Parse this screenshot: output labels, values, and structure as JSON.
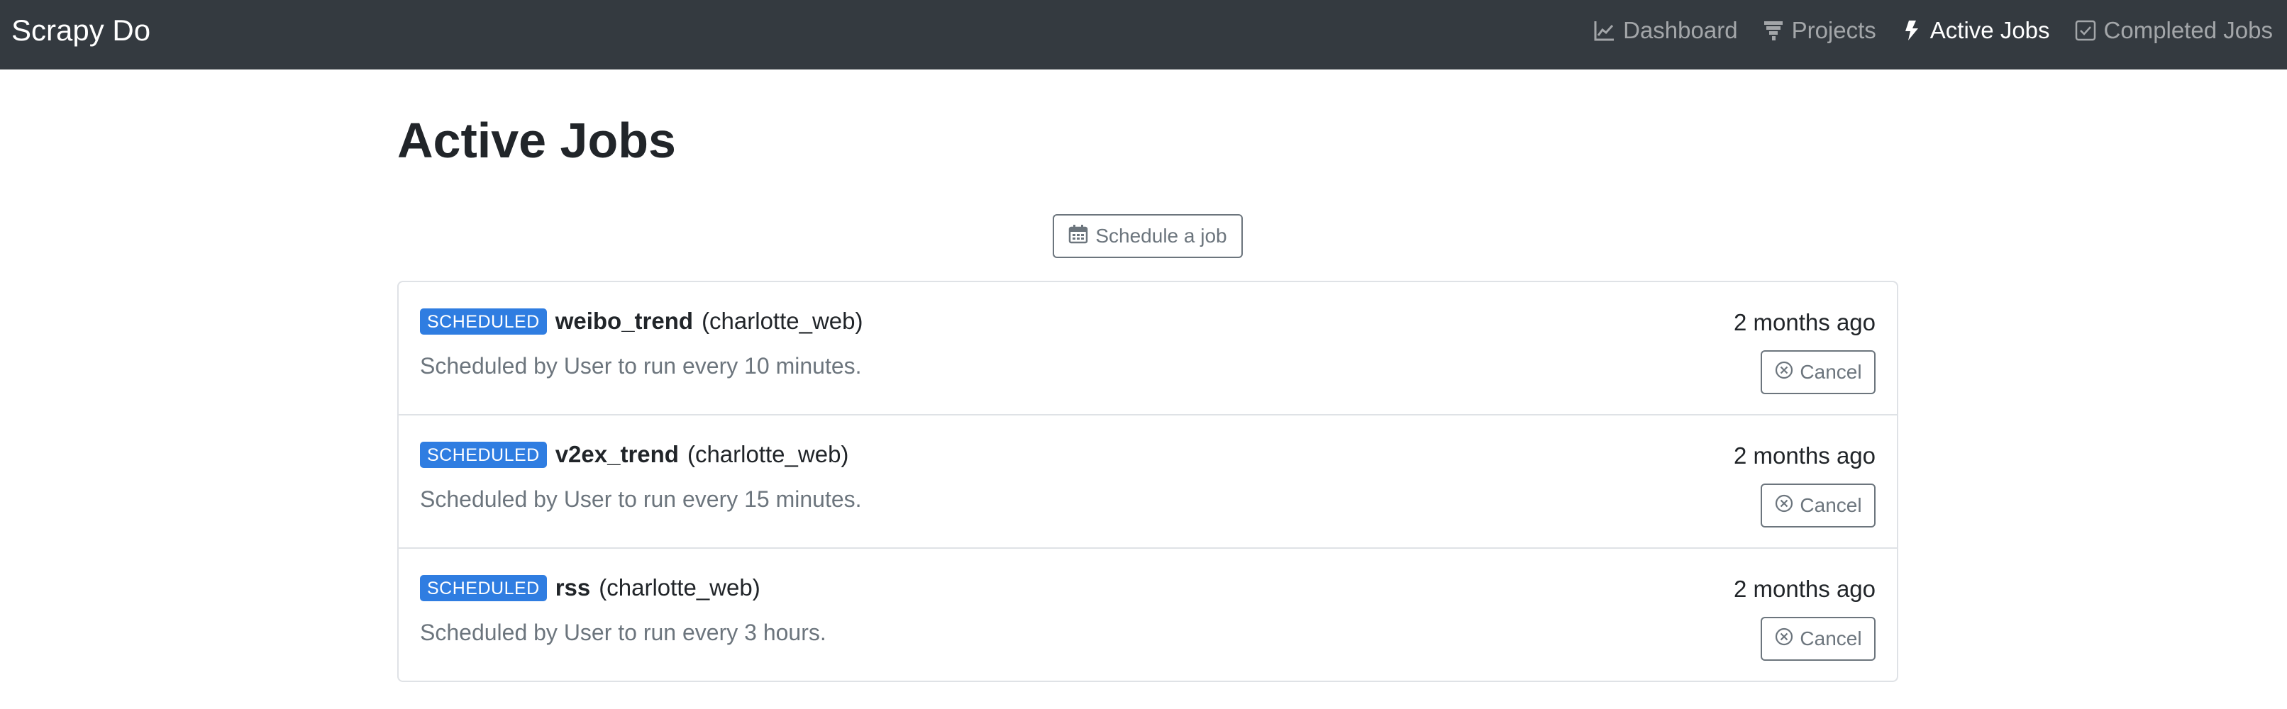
{
  "app": {
    "brand": "Scrapy Do"
  },
  "nav": {
    "items": [
      {
        "label": "Dashboard",
        "icon": "chart-line-icon",
        "active": false
      },
      {
        "label": "Projects",
        "icon": "projects-icon",
        "active": false
      },
      {
        "label": "Active Jobs",
        "icon": "bolt-icon",
        "active": true
      },
      {
        "label": "Completed Jobs",
        "icon": "check-square-icon",
        "active": false
      }
    ]
  },
  "page": {
    "title": "Active Jobs",
    "schedule_button_label": "Schedule a job"
  },
  "jobs": [
    {
      "status": "SCHEDULED",
      "name": "weibo_trend",
      "project": "(charlotte_web)",
      "description": "Scheduled by User to run every 10 minutes.",
      "time": "2 months ago",
      "cancel_label": "Cancel"
    },
    {
      "status": "SCHEDULED",
      "name": "v2ex_trend",
      "project": "(charlotte_web)",
      "description": "Scheduled by User to run every 15 minutes.",
      "time": "2 months ago",
      "cancel_label": "Cancel"
    },
    {
      "status": "SCHEDULED",
      "name": "rss",
      "project": "(charlotte_web)",
      "description": "Scheduled by User to run every 3 hours.",
      "time": "2 months ago",
      "cancel_label": "Cancel"
    }
  ],
  "colors": {
    "navbar_bg": "#343a40",
    "badge_bg": "#2f7de1",
    "muted": "#6c757d"
  }
}
